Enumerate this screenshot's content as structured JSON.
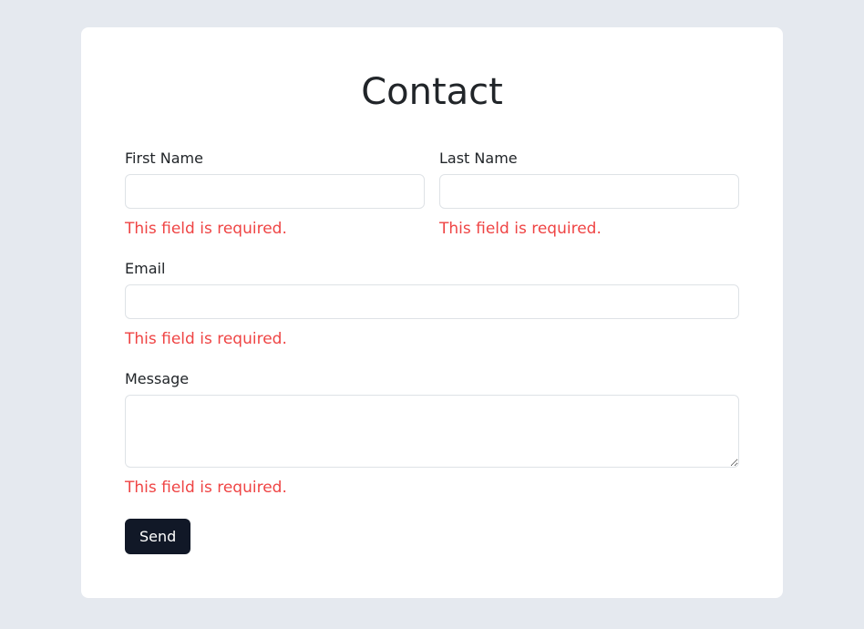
{
  "form": {
    "title": "Contact",
    "fields": {
      "firstName": {
        "label": "First Name",
        "value": "",
        "error": "This field is required."
      },
      "lastName": {
        "label": "Last Name",
        "value": "",
        "error": "This field is required."
      },
      "email": {
        "label": "Email",
        "value": "",
        "error": "This field is required."
      },
      "message": {
        "label": "Message",
        "value": "",
        "error": "This field is required."
      }
    },
    "submit": {
      "label": "Send"
    }
  }
}
